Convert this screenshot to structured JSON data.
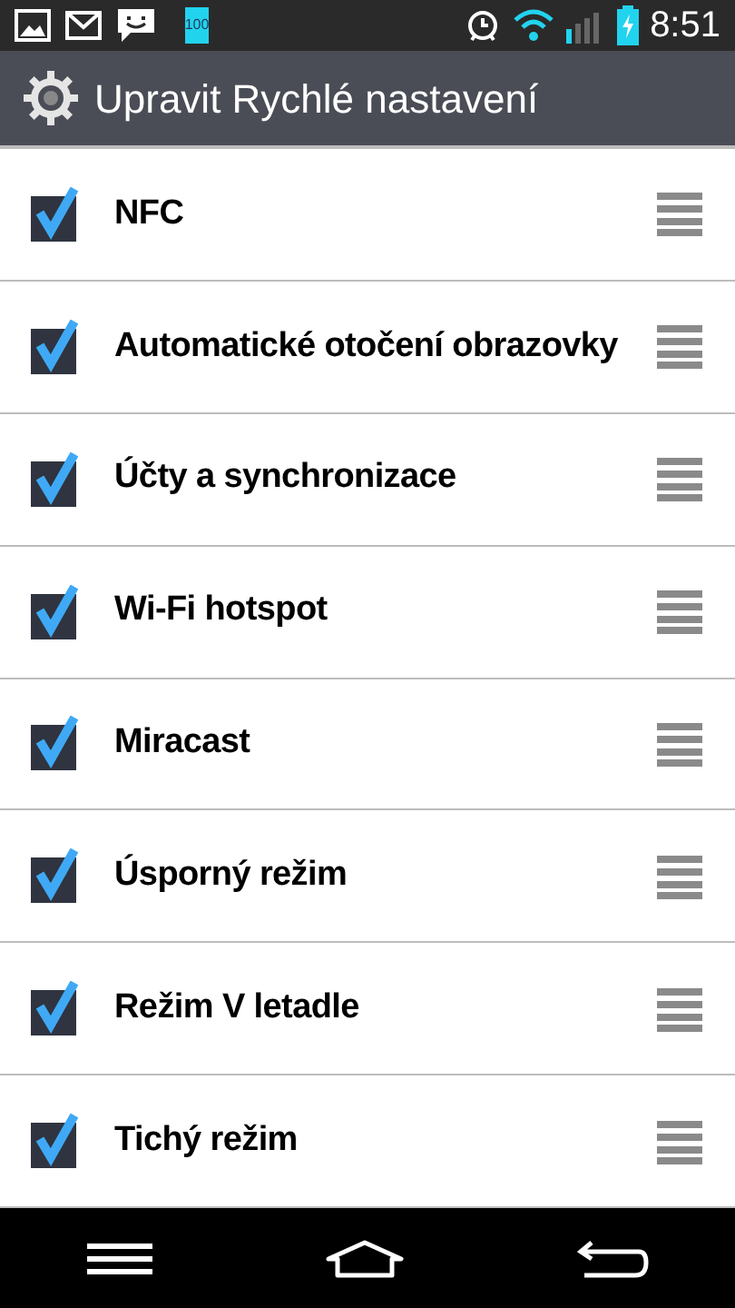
{
  "status_bar": {
    "battery_percent": "100",
    "time": "8:51"
  },
  "header": {
    "title": "Upravit Rychlé nastavení"
  },
  "items": [
    {
      "label": "NFC",
      "checked": true
    },
    {
      "label": "Automatické otočení obrazovky",
      "checked": true
    },
    {
      "label": "Účty a synchronizace",
      "checked": true
    },
    {
      "label": "Wi-Fi hotspot",
      "checked": true
    },
    {
      "label": "Miracast",
      "checked": true
    },
    {
      "label": "Úsporný režim",
      "checked": true
    },
    {
      "label": "Režim V letadle",
      "checked": true
    },
    {
      "label": "Tichý režim",
      "checked": true
    }
  ]
}
